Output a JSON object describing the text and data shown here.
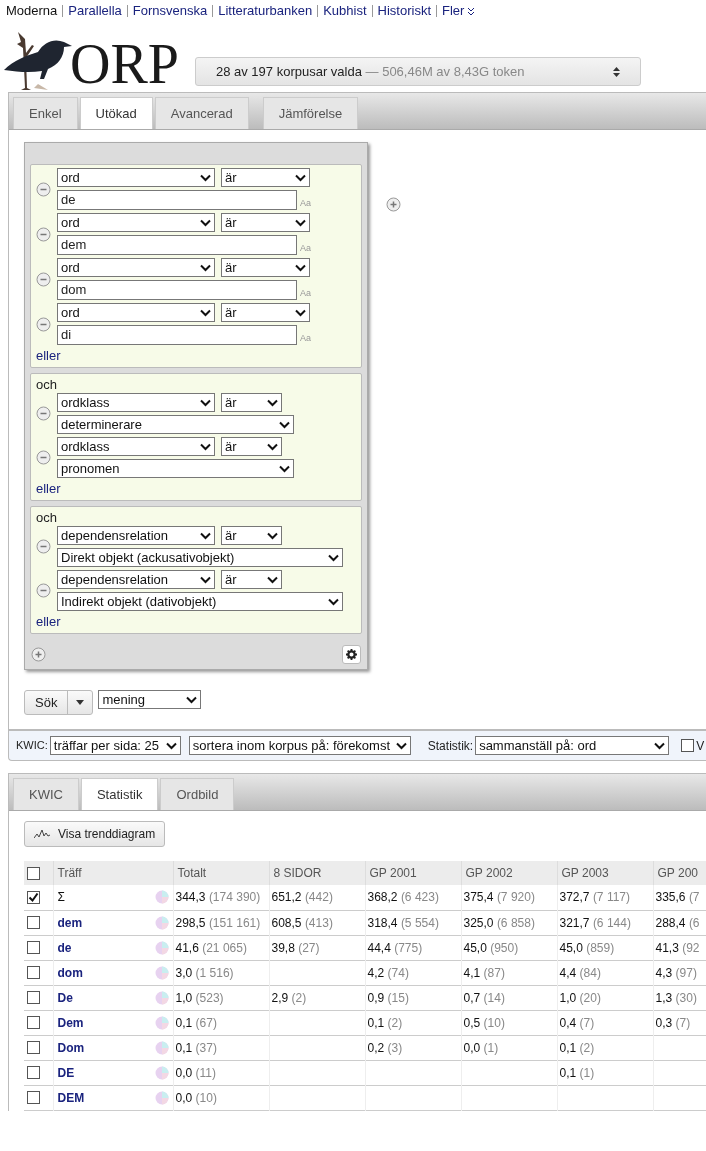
{
  "nav": {
    "links": [
      {
        "label": "Moderna",
        "selected": true
      },
      {
        "label": "Parallella",
        "selected": false
      },
      {
        "label": "Fornsvenska",
        "selected": false
      },
      {
        "label": "Litteraturbanken",
        "selected": false
      },
      {
        "label": "Kubhist",
        "selected": false
      },
      {
        "label": "Historiskt",
        "selected": false
      }
    ],
    "more": "Fler"
  },
  "logo": {
    "text": "ORP"
  },
  "corpus_selector": {
    "selected": "28 av 197 korpusar valda",
    "tokens": "— 506,46M av 8,43G token"
  },
  "search_tabs": [
    {
      "label": "Enkel",
      "selected": false
    },
    {
      "label": "Utökad",
      "selected": true
    },
    {
      "label": "Avancerad",
      "selected": false
    },
    {
      "label": "Jämförelse",
      "selected": false
    }
  ],
  "token_groups": [
    {
      "rows": [
        {
          "kind": "text",
          "attribute": "ord",
          "operator": "är",
          "value": "de",
          "case_hint": "Aa"
        },
        {
          "kind": "text",
          "attribute": "ord",
          "operator": "är",
          "value": "dem",
          "case_hint": "Aa"
        },
        {
          "kind": "text",
          "attribute": "ord",
          "operator": "är",
          "value": "dom",
          "case_hint": "Aa"
        },
        {
          "kind": "text",
          "attribute": "ord",
          "operator": "är",
          "value": "di",
          "case_hint": "Aa"
        }
      ],
      "or_link": "eller"
    },
    {
      "label": "och",
      "rows": [
        {
          "kind": "select",
          "attribute": "ordklass",
          "operator": "är",
          "value": "determinerare"
        },
        {
          "kind": "select",
          "attribute": "ordklass",
          "operator": "är",
          "value": "pronomen"
        }
      ],
      "or_link": "eller"
    },
    {
      "label": "och",
      "rows": [
        {
          "kind": "select",
          "attribute": "dependensrelation",
          "operator": "är",
          "value": "Direkt objekt (ackusativobjekt)"
        },
        {
          "kind": "select",
          "attribute": "dependensrelation",
          "operator": "är",
          "value": "Indirekt objekt (dativobjekt)"
        }
      ],
      "or_link": "eller"
    }
  ],
  "search": {
    "button": "Sök",
    "within": "mening"
  },
  "options": {
    "kwic_label": "KWIC:",
    "hits_per_page": "träffar per sida: 25",
    "sort": "sortera inom korpus på: förekomst",
    "stats_label": "Statistik:",
    "group_by": "sammanställ på: ord",
    "checkbox_label": "V",
    "checked": false
  },
  "result_tabs": [
    {
      "label": "KWIC",
      "selected": false
    },
    {
      "label": "Statistik",
      "selected": true
    },
    {
      "label": "Ordbild",
      "selected": false
    }
  ],
  "trend_button": "Visa trenddiagram",
  "table": {
    "all_checked": false,
    "word_column": "Träff",
    "columns": [
      "Totalt",
      "8 SIDOR",
      "GP 2001",
      "GP 2002",
      "GP 2003",
      "GP 200"
    ],
    "rows": [
      {
        "word": "Σ",
        "kind": "sum",
        "checked": true,
        "cells": [
          [
            "344,3",
            "(174 390)"
          ],
          [
            "651,2",
            "(442)"
          ],
          [
            "368,2",
            "(6 423)"
          ],
          [
            "375,4",
            "(7 920)"
          ],
          [
            "372,7",
            "(7 117)"
          ],
          [
            "335,6",
            "(7"
          ]
        ]
      },
      {
        "word": "dem",
        "kind": "word",
        "checked": false,
        "cells": [
          [
            "298,5",
            "(151 161)"
          ],
          [
            "608,5",
            "(413)"
          ],
          [
            "318,4",
            "(5 554)"
          ],
          [
            "325,0",
            "(6 858)"
          ],
          [
            "321,7",
            "(6 144)"
          ],
          [
            "288,4",
            "(6"
          ]
        ]
      },
      {
        "word": "de",
        "kind": "word",
        "checked": false,
        "cells": [
          [
            "41,6",
            "(21 065)"
          ],
          [
            "39,8",
            "(27)"
          ],
          [
            "44,4",
            "(775)"
          ],
          [
            "45,0",
            "(950)"
          ],
          [
            "45,0",
            "(859)"
          ],
          [
            "41,3",
            "(92"
          ]
        ]
      },
      {
        "word": "dom",
        "kind": "word",
        "checked": false,
        "cells": [
          [
            "3,0",
            "(1 516)"
          ],
          null,
          [
            "4,2",
            "(74)"
          ],
          [
            "4,1",
            "(87)"
          ],
          [
            "4,4",
            "(84)"
          ],
          [
            "4,3",
            "(97)"
          ]
        ]
      },
      {
        "word": "De",
        "kind": "word",
        "checked": false,
        "cells": [
          [
            "1,0",
            "(523)"
          ],
          [
            "2,9",
            "(2)"
          ],
          [
            "0,9",
            "(15)"
          ],
          [
            "0,7",
            "(14)"
          ],
          [
            "1,0",
            "(20)"
          ],
          [
            "1,3",
            "(30)"
          ]
        ]
      },
      {
        "word": "Dem",
        "kind": "word",
        "checked": false,
        "cells": [
          [
            "0,1",
            "(67)"
          ],
          null,
          [
            "0,1",
            "(2)"
          ],
          [
            "0,5",
            "(10)"
          ],
          [
            "0,4",
            "(7)"
          ],
          [
            "0,3",
            "(7)"
          ]
        ]
      },
      {
        "word": "Dom",
        "kind": "word",
        "checked": false,
        "cells": [
          [
            "0,1",
            "(37)"
          ],
          null,
          [
            "0,2",
            "(3)"
          ],
          [
            "0,0",
            "(1)"
          ],
          [
            "0,1",
            "(2)"
          ],
          null
        ]
      },
      {
        "word": "DE",
        "kind": "word",
        "checked": false,
        "cells": [
          [
            "0,0",
            "(11)"
          ],
          null,
          null,
          null,
          [
            "0,1",
            "(1)"
          ],
          null
        ]
      },
      {
        "word": "DEM",
        "kind": "word",
        "checked": false,
        "cells": [
          [
            "0,0",
            "(10)"
          ],
          null,
          null,
          null,
          null,
          null
        ]
      }
    ]
  }
}
